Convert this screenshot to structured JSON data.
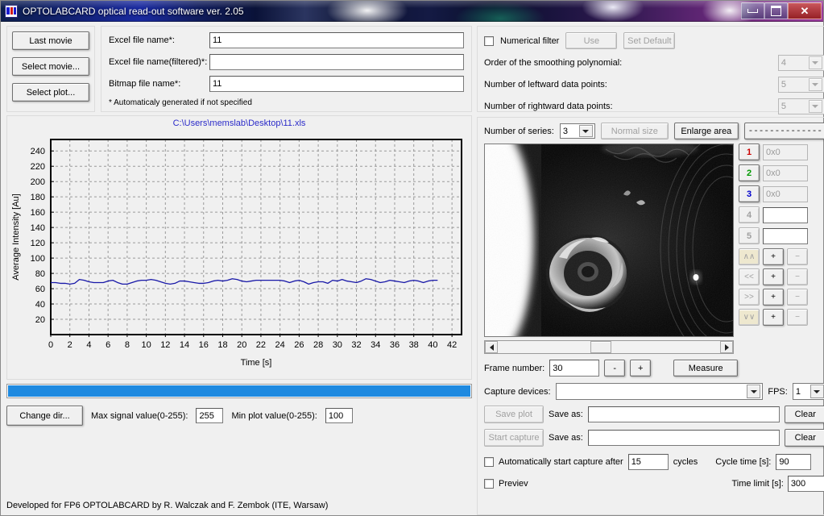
{
  "window": {
    "title": "OPTOLABCARD optical read-out software ver. 2.05",
    "minimize_label": "minimize",
    "maximize_label": "maximize",
    "close_label": "✕"
  },
  "left_buttons": [
    {
      "label": "Last movie"
    },
    {
      "label": "Select movie..."
    },
    {
      "label": "Select plot..."
    }
  ],
  "files": {
    "rows": [
      {
        "label": "Excel file name*:",
        "value": "11"
      },
      {
        "label": "Excel file name(filtered)*:",
        "value": ""
      },
      {
        "label": "Bitmap file name*:",
        "value": "11"
      }
    ],
    "note": "* Automaticaly generated if not specified"
  },
  "chart_data": {
    "type": "line",
    "title": "C:\\Users\\memslab\\Desktop\\11.xls",
    "xlabel": "Time [s]",
    "ylabel": "Average Intensity [Au]",
    "xlim": [
      0,
      43
    ],
    "ylim": [
      0,
      255
    ],
    "xticks": [
      0,
      2,
      4,
      6,
      8,
      10,
      12,
      14,
      16,
      18,
      20,
      22,
      24,
      26,
      28,
      30,
      32,
      34,
      36,
      38,
      40,
      42
    ],
    "yticks": [
      20,
      40,
      60,
      80,
      100,
      120,
      140,
      160,
      180,
      200,
      220,
      240
    ],
    "grid": true,
    "legend": "none",
    "line_color": "#1818a8",
    "series": [
      {
        "name": "Average Intensity",
        "x": [
          0.0,
          0.5,
          1.0,
          1.5,
          2.0,
          2.5,
          3.0,
          3.5,
          4.0,
          4.5,
          5.0,
          5.5,
          6.0,
          6.5,
          7.0,
          7.5,
          8.0,
          8.5,
          9.0,
          9.5,
          10.0,
          10.5,
          11.0,
          11.5,
          12.0,
          12.5,
          13.0,
          13.5,
          14.0,
          14.5,
          15.0,
          15.5,
          16.0,
          16.5,
          17.0,
          17.5,
          18.0,
          18.5,
          19.0,
          19.5,
          20.0,
          20.5,
          21.0,
          21.5,
          22.0,
          22.5,
          23.0,
          23.5,
          24.0,
          24.5,
          25.0,
          25.5,
          26.0,
          26.5,
          27.0,
          27.5,
          28.0,
          28.5,
          29.0,
          29.5,
          30.0,
          30.5,
          31.0,
          31.5,
          32.0,
          32.5,
          33.0,
          33.5,
          34.0,
          34.5,
          35.0,
          35.5,
          36.0,
          36.5,
          37.0,
          37.5,
          38.0,
          38.5,
          39.0,
          39.5,
          40.0,
          40.5
        ],
        "y": [
          68,
          68,
          67,
          67,
          66,
          67,
          72,
          71,
          69,
          68,
          68,
          68,
          70,
          71,
          68,
          66,
          66,
          68,
          70,
          71,
          71,
          72,
          71,
          69,
          67,
          66,
          67,
          70,
          70,
          69,
          68,
          67,
          67,
          68,
          70,
          71,
          70,
          71,
          73,
          72,
          70,
          69,
          70,
          71,
          71,
          71,
          71,
          71,
          71,
          70,
          68,
          70,
          71,
          69,
          66,
          68,
          69,
          69,
          67,
          71,
          70,
          72,
          70,
          69,
          68,
          70,
          73,
          72,
          70,
          68,
          69,
          71,
          70,
          69,
          68,
          70,
          71,
          70,
          68,
          70,
          71,
          71
        ]
      }
    ]
  },
  "progress": {
    "percent": 100
  },
  "settings": {
    "change_dir_label": "Change dir...",
    "max_signal_label": "Max signal value(0-255):",
    "max_signal_value": "255",
    "min_plot_label": "Min plot value(0-255):",
    "min_plot_value": "100"
  },
  "footer": {
    "text": "Developed for FP6 OPTOLABCARD by R. Walczak and F. Zembok (ITE, Warsaw)"
  },
  "filter": {
    "checkbox_label": "Numerical filter",
    "checked": false,
    "use_label": "Use",
    "set_default_label": "Set Default",
    "rows": [
      {
        "label": "Order of the smoothing polynomial:",
        "value": "4"
      },
      {
        "label": "Number of leftward data points:",
        "value": "5"
      },
      {
        "label": "Number of rightward data points:",
        "value": "5"
      }
    ]
  },
  "series_panel": {
    "count_label": "Number of series:",
    "count_value": "3",
    "normal_size_label": "Normal size",
    "enlarge_area_label": "Enlarge area",
    "dashed_button_label": "--------------",
    "series": [
      {
        "index": "1",
        "color": "#cc0000",
        "value": "0x0",
        "enabled": true
      },
      {
        "index": "2",
        "color": "#009900",
        "value": "0x0",
        "enabled": true
      },
      {
        "index": "3",
        "color": "#0000cc",
        "value": "0x0",
        "enabled": true
      },
      {
        "index": "4",
        "color": "#909090",
        "value": "",
        "enabled": false
      },
      {
        "index": "5",
        "color": "#909090",
        "value": "",
        "enabled": false
      }
    ],
    "nav_rows": [
      {
        "main": "∧∧",
        "plus": "+",
        "minus": "−",
        "highlight": true
      },
      {
        "main": "<<",
        "plus": "+",
        "minus": "−",
        "highlight": false
      },
      {
        "main": ">>",
        "plus": "+",
        "minus": "−",
        "highlight": false
      },
      {
        "main": "∨∨",
        "plus": "+",
        "minus": "−",
        "highlight": true
      }
    ]
  },
  "frame": {
    "label": "Frame number:",
    "value": "30",
    "minus_label": "-",
    "plus_label": "+",
    "measure_label": "Measure"
  },
  "capture": {
    "devices_label": "Capture devices:",
    "devices_value": "",
    "fps_label": "FPS:",
    "fps_value": "1",
    "save_plot_label": "Save plot",
    "save_plot_as_label": "Save as:",
    "save_plot_as_value": "",
    "save_plot_clear_label": "Clear",
    "start_capture_label": "Start capture",
    "start_capture_as_label": "Save as:",
    "start_capture_as_value": "",
    "start_capture_clear_label": "Clear",
    "auto_start_label": "Automatically start capture after",
    "auto_start_cycles": "15",
    "cycles_label": "cycles",
    "cycle_time_label": "Cycle time [s]:",
    "cycle_time_value": "90",
    "preview_label": "Previev",
    "time_limit_label": "Time limit [s]:",
    "time_limit_value": "300"
  }
}
